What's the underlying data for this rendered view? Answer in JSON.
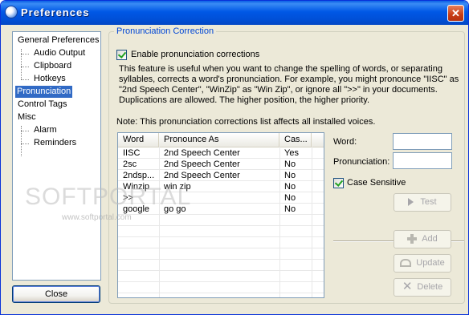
{
  "window": {
    "title": "Preferences",
    "close_glyph": "✕"
  },
  "tree": {
    "items": [
      {
        "label": "General Preferences",
        "level": 0,
        "selected": false
      },
      {
        "label": "Audio Output",
        "level": 1,
        "selected": false
      },
      {
        "label": "Clipboard",
        "level": 1,
        "selected": false
      },
      {
        "label": "Hotkeys",
        "level": 1,
        "selected": false
      },
      {
        "label": "Pronunciation",
        "level": 0,
        "selected": true
      },
      {
        "label": "Control Tags",
        "level": 0,
        "selected": false
      },
      {
        "label": "Misc",
        "level": 0,
        "selected": false
      },
      {
        "label": "Alarm",
        "level": 1,
        "selected": false
      },
      {
        "label": "Reminders",
        "level": 1,
        "selected": false
      }
    ]
  },
  "close_button_label": "Close",
  "group": {
    "title": "Pronunciation Correction",
    "enable_label": "Enable pronunciation corrections",
    "enable_checked": true,
    "description": "This feature is useful when you want to change the spelling of words, or separating syllables, corrects a word's pronunciation. For example, you might pronounce \"IISC\" as \"2nd Speech Center\",  \"WinZip\" as \"Win Zip\", or ignore all \">>\" in your documents. Duplications are allowed. The higher position, the higher priority.",
    "note": "Note: This pronunciation corrections list affects all installed voices."
  },
  "list": {
    "columns": [
      "Word",
      "Pronounce As",
      "Cas..."
    ],
    "rows": [
      [
        "IISC",
        "2nd Speech Center",
        "Yes"
      ],
      [
        "2sc",
        "2nd Speech Center",
        "No"
      ],
      [
        "2ndsp...",
        "2nd Speech Center",
        "No"
      ],
      [
        "Winzip",
        "win zip",
        "No"
      ],
      [
        ">>",
        "",
        "No"
      ],
      [
        "google",
        "go go",
        "No"
      ]
    ]
  },
  "form": {
    "word_label": "Word:",
    "word_value": "",
    "pronunciation_label": "Pronunciation:",
    "pronunciation_value": "",
    "case_label": "Case Sensitive",
    "case_checked": true,
    "test_label": "Test",
    "add_label": "Add",
    "update_label": "Update",
    "delete_label": "Delete"
  },
  "watermark": {
    "text": "SOFTPORTAL",
    "sub": "www.softportal.com"
  }
}
